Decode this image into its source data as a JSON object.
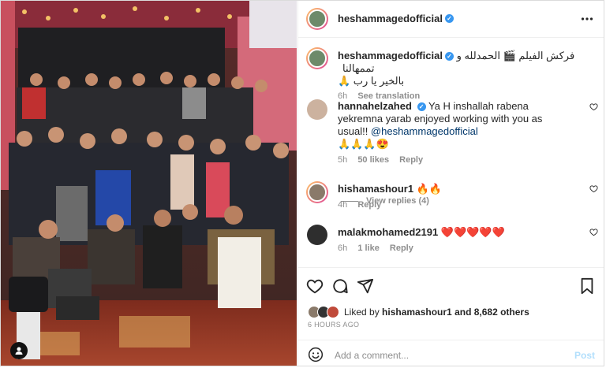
{
  "post": {
    "username": "heshammagedofficial",
    "more_icon": "ellipsis-icon"
  },
  "caption": {
    "username": "heshammagedofficial",
    "text_line1": "فركش الفيلم 🎬 الحمدلله و تممهالنا",
    "text_line2": "بالخير يا رب 🙏",
    "time": "6h",
    "see_translation": "See translation"
  },
  "comments": [
    {
      "username": "hannahelzahed",
      "text_pre": "Ya H inshallah rabena yekremna yarab enjoyed working with you as usual!! ",
      "mention": "@heshammagedofficial",
      "text_line3": "🙏🙏🙏😍",
      "time": "5h",
      "likes": "50 likes",
      "reply": "Reply",
      "view_replies": "View replies (4)"
    },
    {
      "username": "hishamashour1",
      "text": "🔥🔥",
      "time": "4h",
      "reply": "Reply"
    },
    {
      "username": "malakmohamed2191",
      "text": "❤️❤️❤️❤️❤️",
      "time": "6h",
      "likes": "1 like",
      "reply": "Reply"
    }
  ],
  "likes": {
    "prefix": "Liked by ",
    "user": "hishamashour1",
    "suffix": " and 8,682 others"
  },
  "timestamp": "6 HOURS AGO",
  "add_comment": {
    "placeholder": "Add a comment...",
    "post_label": "Post"
  },
  "colors": {
    "link": "#00376b",
    "verified": "#3897f0",
    "post_disabled": "#b2dffc",
    "heart_red": "#ed4956"
  }
}
